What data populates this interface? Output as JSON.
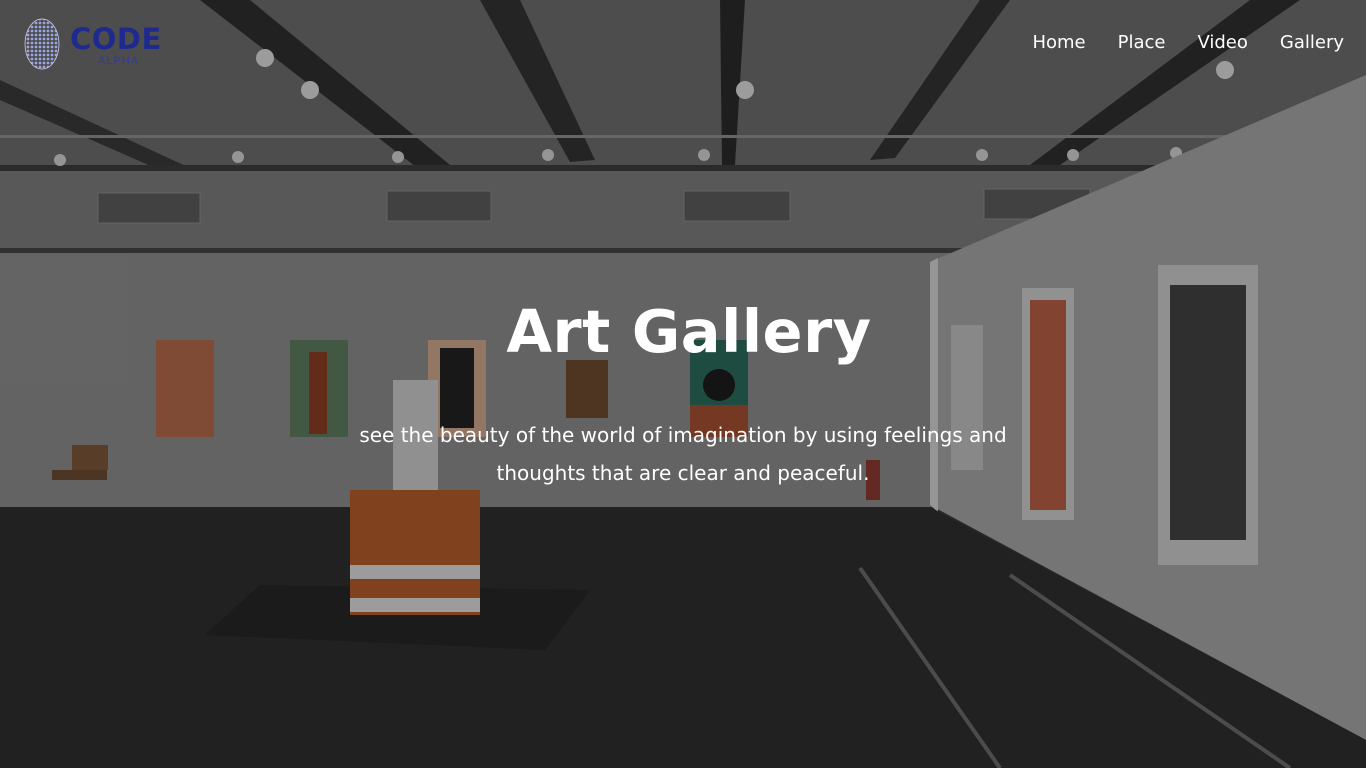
{
  "logo": {
    "title": "CODE",
    "subtitle": "ALPHA",
    "icon": "globe-dots-icon"
  },
  "nav": {
    "links": [
      {
        "label": "Home"
      },
      {
        "label": "Place"
      },
      {
        "label": "Video"
      },
      {
        "label": "Gallery"
      }
    ]
  },
  "hero": {
    "title": "Art Gallery",
    "subtitle": "see the beauty of the world of imagination by using feelings and thoughts that are clear and peaceful."
  },
  "colors": {
    "logo_blue": "#1f2a8f",
    "text": "#ffffff",
    "overlay": "rgba(0,0,0,0.28)"
  }
}
